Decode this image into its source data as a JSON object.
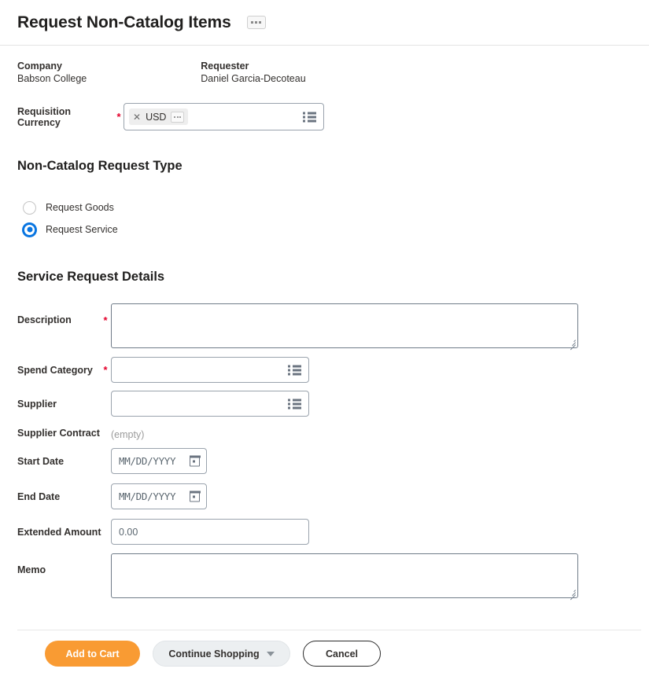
{
  "header": {
    "title": "Request Non-Catalog Items",
    "menu_icon": "ellipsis-icon"
  },
  "summary": {
    "company_label": "Company",
    "company_value": "Babson College",
    "requester_label": "Requester",
    "requester_value": "Daniel Garcia-Decoteau"
  },
  "currency": {
    "label": "Requisition Currency",
    "required_marker": "*",
    "selected": "USD",
    "remove_icon": "close-icon",
    "more_icon": "ellipsis-icon",
    "prompt_icon": "list-prompt-icon"
  },
  "request_type": {
    "heading": "Non-Catalog Request Type",
    "options": [
      {
        "label": "Request Goods",
        "selected": false
      },
      {
        "label": "Request Service",
        "selected": true
      }
    ]
  },
  "service_details": {
    "heading": "Service Request Details",
    "description": {
      "label": "Description",
      "required_marker": "*",
      "value": ""
    },
    "spend_category": {
      "label": "Spend Category",
      "required_marker": "*",
      "value": "",
      "prompt_icon": "list-prompt-icon"
    },
    "supplier": {
      "label": "Supplier",
      "value": "",
      "prompt_icon": "list-prompt-icon"
    },
    "supplier_contract": {
      "label": "Supplier Contract",
      "value": "(empty)"
    },
    "start_date": {
      "label": "Start Date",
      "placeholder": "MM/DD/YYYY",
      "calendar_icon": "calendar-icon"
    },
    "end_date": {
      "label": "End Date",
      "placeholder": "MM/DD/YYYY",
      "calendar_icon": "calendar-icon"
    },
    "extended_amount": {
      "label": "Extended Amount",
      "value": "0.00"
    },
    "memo": {
      "label": "Memo",
      "value": ""
    }
  },
  "footer": {
    "add_to_cart": "Add to Cart",
    "continue_shopping": "Continue Shopping",
    "cancel": "Cancel",
    "caret_icon": "chevron-down-icon"
  },
  "colors": {
    "primary_button": "#f99b33",
    "required_star": "#e4002b",
    "radio_selected": "#0875e1"
  }
}
